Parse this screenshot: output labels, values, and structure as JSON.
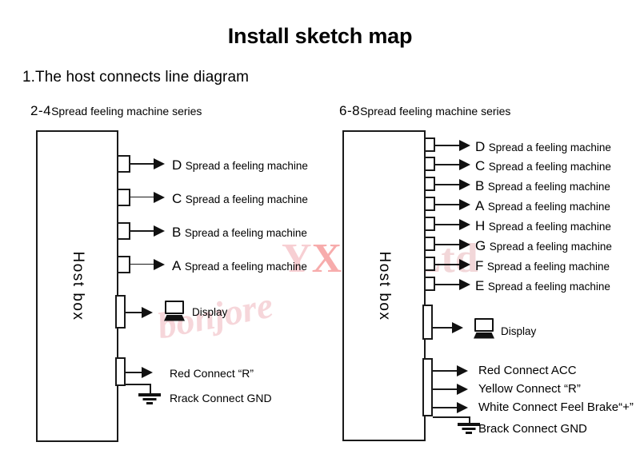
{
  "title": "Install sketch map",
  "section": "1.The host connects line diagram",
  "left": {
    "series_range": "2-4",
    "series_text": "Spread feeling machine series",
    "box_label": "Host box",
    "ports": [
      {
        "key": "D",
        "text": "Spread a feeling machine"
      },
      {
        "key": "C",
        "text": "Spread a feeling machine"
      },
      {
        "key": "B",
        "text": "Spread a feeling machine"
      },
      {
        "key": "A",
        "text": "Spread a feeling machine"
      }
    ],
    "display_label": "Display",
    "power_lines": [
      "Red Connect “R”",
      "Rrack  Connect  GND"
    ]
  },
  "right": {
    "series_range": "6-8",
    "series_text": "Spread feeling machine series",
    "box_label": "Host box",
    "ports": [
      {
        "key": "D",
        "text": "Spread a feeling machine"
      },
      {
        "key": "C",
        "text": "Spread a feeling machine"
      },
      {
        "key": "B",
        "text": "Spread a feeling machine"
      },
      {
        "key": "A",
        "text": "Spread a feeling machine"
      },
      {
        "key": "H",
        "text": "Spread a feeling machine"
      },
      {
        "key": "G",
        "text": "Spread a feeling machine"
      },
      {
        "key": "F",
        "text": "Spread a feeling machine"
      },
      {
        "key": "E",
        "text": "Spread a feeling machine"
      }
    ],
    "display_label": "Display",
    "power_lines": [
      "Red Connect  ACC",
      "Yellow  Connect   “R”",
      "White Connect Feel Brake“+”",
      "Brack Connect GND"
    ]
  },
  "watermarks": {
    "brand": "bonjore",
    "company_parts": [
      "Y",
      "X",
      "C",
      "o. Ltd"
    ]
  }
}
